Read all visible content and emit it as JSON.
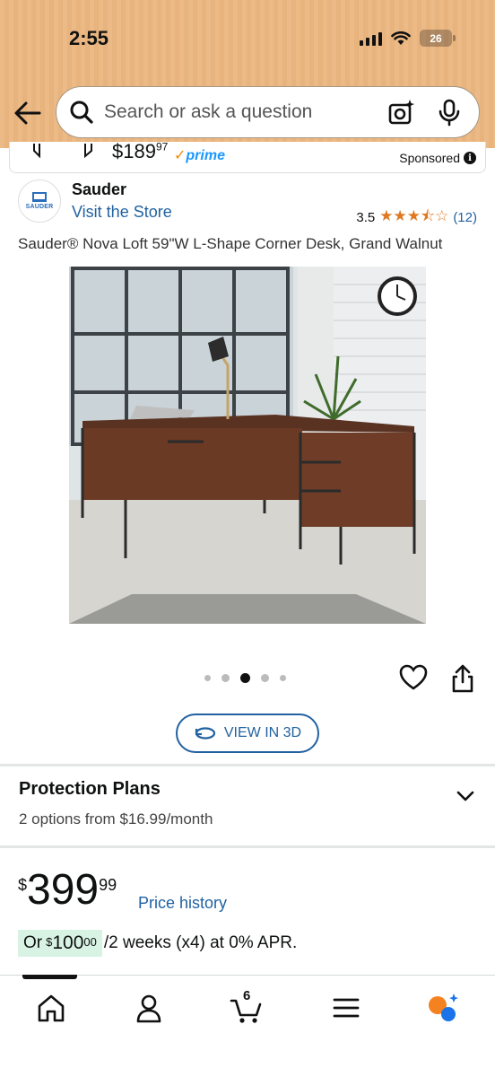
{
  "status_bar": {
    "time": "2:55",
    "battery": "26"
  },
  "search": {
    "placeholder": "Search or ask a question"
  },
  "sponsored": {
    "price_whole": "$189",
    "price_fraction": "97",
    "prime": "prime",
    "label": "Sponsored"
  },
  "brand": {
    "logo_text": "SAUDER",
    "name": "Sauder",
    "store_link": "Visit the Store"
  },
  "rating": {
    "value": "3.5",
    "stars": 3.5,
    "count": "(12)"
  },
  "product": {
    "title": "Sauder® Nova Loft 59\"W L-Shape Corner Desk, Grand Walnut"
  },
  "gallery": {
    "image_count": 5,
    "active_index": 2
  },
  "view3d": {
    "label": "VIEW IN 3D"
  },
  "protection": {
    "title": "Protection Plans",
    "subtitle": "2 options from $16.99/month"
  },
  "price": {
    "currency": "$",
    "whole": "399",
    "fraction": "99",
    "history_link": "Price history"
  },
  "installment": {
    "prefix": "Or ",
    "currency": "$",
    "whole": "100",
    "fraction": "00",
    "suffix": "/2 weeks (x4) at 0% APR."
  },
  "nav": {
    "items": [
      "home-icon",
      "account-icon",
      "cart-icon",
      "menu-icon",
      "rufus-icon"
    ],
    "cart_count": "6"
  },
  "colors": {
    "header_bg": "#ebba86",
    "link": "#2162a1",
    "star": "#de7921",
    "prime": "#1a98ff",
    "installment_bg": "#d8f3e3"
  }
}
